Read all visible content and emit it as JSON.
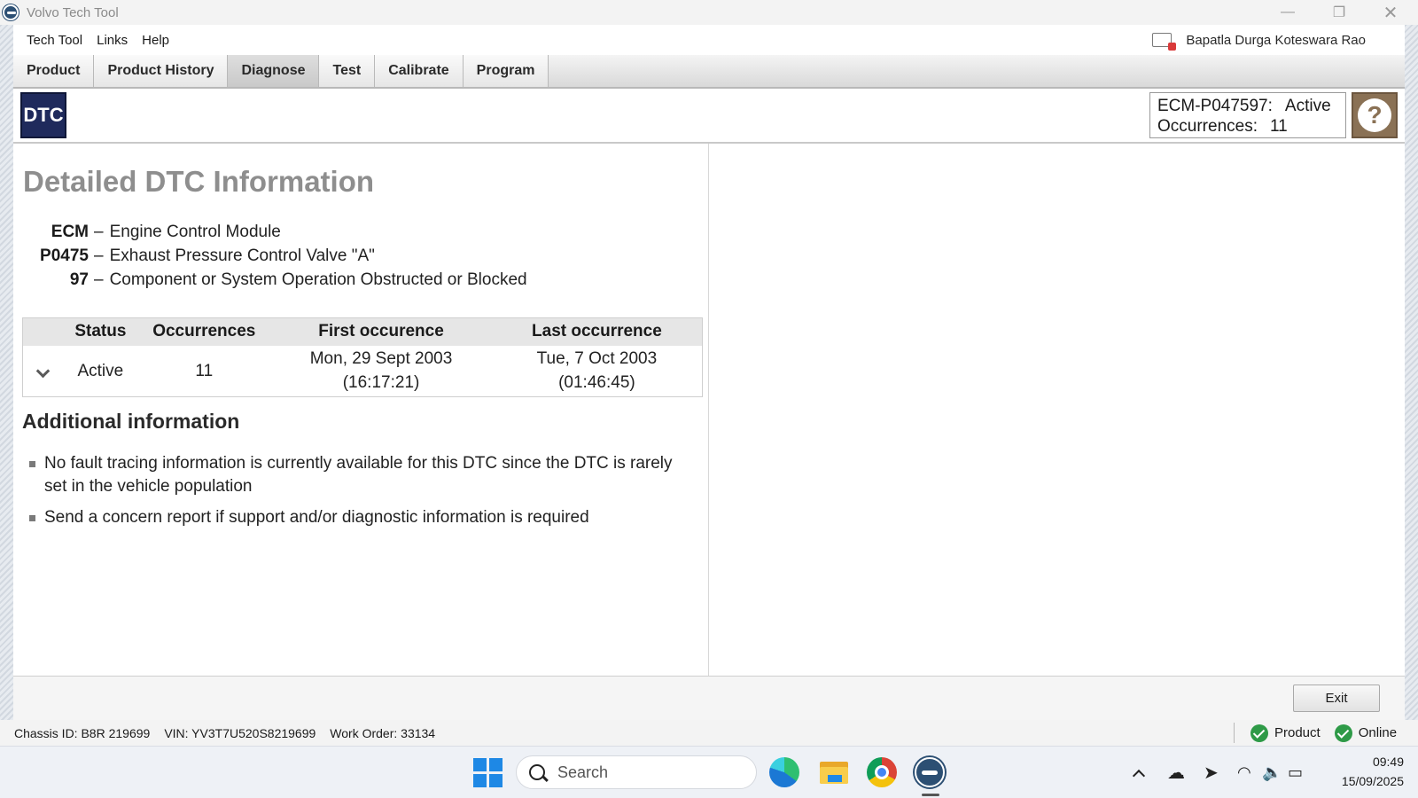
{
  "window": {
    "title": "Volvo Tech Tool",
    "app_icon": "volvo-tech-tool-icon",
    "controls": {
      "minimize": "—",
      "maximize": "❐",
      "close": "✕"
    }
  },
  "menu": {
    "items": [
      "Tech Tool",
      "Links",
      "Help"
    ],
    "user_name": "Bapatla Durga Koteswara Rao",
    "user_icon": "user-card-icon"
  },
  "tabs": [
    {
      "label": "Product",
      "active": false
    },
    {
      "label": "Product History",
      "active": false
    },
    {
      "label": "Diagnose",
      "active": true
    },
    {
      "label": "Test",
      "active": false
    },
    {
      "label": "Calibrate",
      "active": false
    },
    {
      "label": "Program",
      "active": false
    }
  ],
  "header": {
    "badge": "DTC",
    "ecm_code": "ECM-P047597:",
    "ecm_status": "Active",
    "occurrences_label": "Occurrences:",
    "occurrences_value": "11",
    "help_glyph": "?"
  },
  "detail": {
    "title": "Detailed DTC Information",
    "definitions": [
      {
        "code": "ECM",
        "dash": "–",
        "description": "Engine Control Module"
      },
      {
        "code": "P0475",
        "dash": "–",
        "description": "Exhaust Pressure Control Valve \"A\""
      },
      {
        "code": "97",
        "dash": "–",
        "description": "Component or System Operation Obstructed or Blocked"
      }
    ],
    "table": {
      "headers": [
        "Status",
        "Occurrences",
        "First occurence",
        "Last occurrence"
      ],
      "rows": [
        {
          "status": "Active",
          "occurrences": "11",
          "first_date": "Mon, 29 Sept 2003",
          "first_time": "(16:17:21)",
          "last_date": "Tue, 7 Oct 2003",
          "last_time": "(01:46:45)"
        }
      ]
    },
    "additional_title": "Additional information",
    "additional_items": [
      "No fault tracing information is currently available for this DTC since the DTC is rarely set in the vehicle population",
      "Send a concern report if support and/or diagnostic information is required"
    ]
  },
  "footer": {
    "exit_label": "Exit"
  },
  "statusbar": {
    "chassis": "Chassis ID: B8R 219699",
    "vin": "VIN: YV3T7U520S8219699",
    "work_order": "Work Order: 33134",
    "product_label": "Product",
    "online_label": "Online"
  },
  "taskbar": {
    "search_placeholder": "Search",
    "time": "09:49",
    "date": "15/09/2025"
  },
  "colors": {
    "dtc_badge": "#1f2a5c",
    "help_button": "#8a7155",
    "status_ok": "#2e9a47",
    "title_gray": "#8e8e8e"
  }
}
